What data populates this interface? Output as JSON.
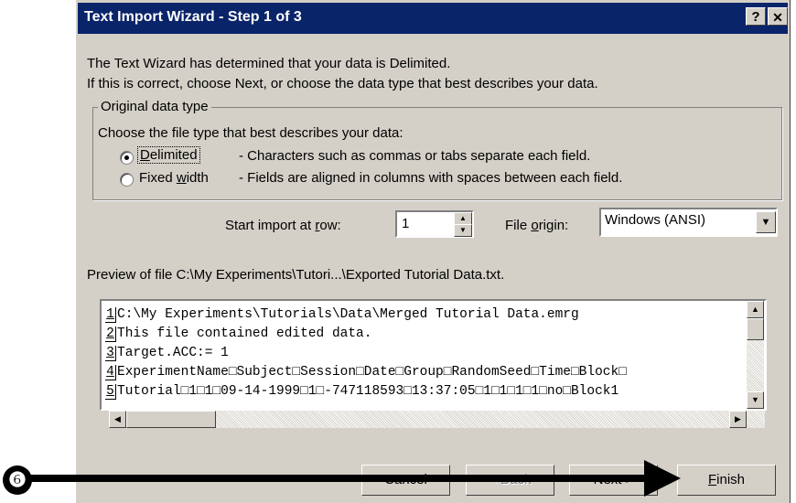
{
  "dialog": {
    "title": "Text Import Wizard - Step 1 of 3",
    "help_label": "?",
    "close_label": "✕",
    "intro_line1": "The Text Wizard has determined that your data is Delimited.",
    "intro_line2": "If this is correct, choose Next, or choose the data type that best describes your data."
  },
  "original_data_type": {
    "legend": "Original data type",
    "prompt": "Choose the file type that best describes your data:",
    "options": [
      {
        "label_pre": "",
        "label_key": "D",
        "label_post": "elimited",
        "description": "- Characters such as commas or tabs separate each field.",
        "selected": true
      },
      {
        "label_pre": "Fixed ",
        "label_key": "w",
        "label_post": "idth",
        "description": "- Fields are aligned in columns with spaces between each field.",
        "selected": false
      }
    ]
  },
  "import_row": {
    "label_pre": "Start import at ",
    "label_key": "r",
    "label_post": "ow:",
    "value": "1"
  },
  "file_origin": {
    "label_pre": "File ",
    "label_key": "o",
    "label_post": "rigin:",
    "value": "Windows (ANSI)"
  },
  "preview": {
    "label": "Preview of file C:\\My Experiments\\Tutori...\\Exported Tutorial Data.txt.",
    "rows": [
      {
        "num": "1",
        "text": "C:\\My Experiments\\Tutorials\\Data\\Merged Tutorial Data.emrg"
      },
      {
        "num": "2",
        "text": "This file contained edited data."
      },
      {
        "num": "3",
        "text": "Target.ACC:= 1"
      },
      {
        "num": "4",
        "text": "ExperimentName□Subject□Session□Date□Group□RandomSeed□Time□Block□"
      },
      {
        "num": "5",
        "text": "Tutorial□1□1□09-14-1999□1□-747118593□13:37:05□1□1□1□1□no□Block1"
      }
    ]
  },
  "buttons": {
    "cancel": "Cancel",
    "back": "< Back",
    "next": "Next >",
    "finish_pre": "",
    "finish_key": "F",
    "finish_post": "inish"
  },
  "callout": {
    "step": "❻"
  }
}
